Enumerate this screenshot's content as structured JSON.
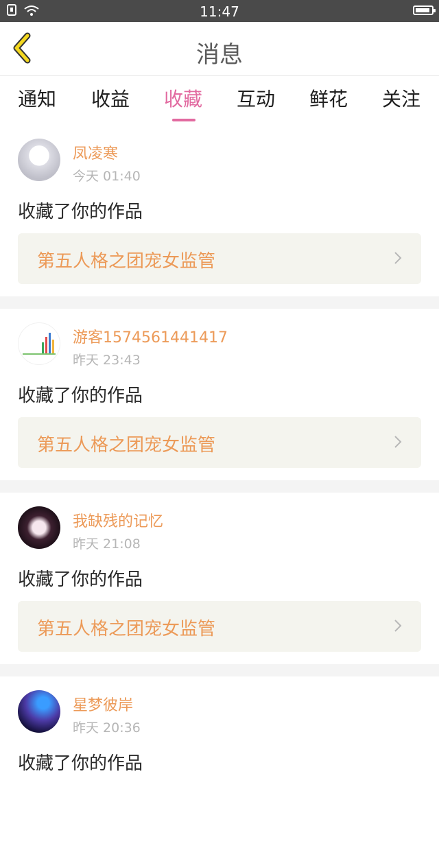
{
  "status_bar": {
    "time": "11:47"
  },
  "header": {
    "title": "消息"
  },
  "tabs": [
    {
      "label": "通知"
    },
    {
      "label": "收益"
    },
    {
      "label": "收藏",
      "active": true
    },
    {
      "label": "互动"
    },
    {
      "label": "鲜花"
    },
    {
      "label": "关注"
    }
  ],
  "items": [
    {
      "name": "凤凌寒",
      "time": "今天 01:40",
      "action": "收藏了你的作品",
      "work_title": "第五人格之团宠女监管"
    },
    {
      "name": "游客1574561441417",
      "time": "昨天 23:43",
      "action": "收藏了你的作品",
      "work_title": "第五人格之团宠女监管"
    },
    {
      "name": "我缺残的记忆",
      "time": "昨天 21:08",
      "action": "收藏了你的作品",
      "work_title": "第五人格之团宠女监管"
    },
    {
      "name": "星梦彼岸",
      "time": "昨天 20:36",
      "action": "收藏了你的作品"
    }
  ],
  "colors": {
    "accent": "#e26aa0",
    "name": "#ec9a58",
    "status_bar": "#4a4a4a"
  }
}
